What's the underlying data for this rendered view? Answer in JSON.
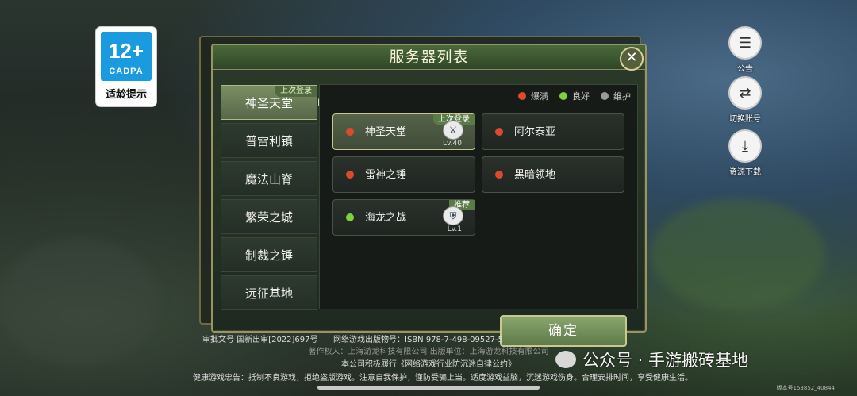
{
  "age_badge": {
    "rating": "12+",
    "org": "CADPA",
    "tip": "适龄提示"
  },
  "side_buttons": [
    {
      "icon": "notice-icon",
      "glyph": "☰",
      "label": "公告"
    },
    {
      "icon": "switch-account-icon",
      "glyph": "⇄",
      "label": "切换账号"
    },
    {
      "icon": "download-icon",
      "glyph": "⤓",
      "label": "资源下载"
    }
  ],
  "panel": {
    "title": "服务器列表",
    "close_glyph": "✕",
    "tabs": [
      {
        "label": "神圣天堂",
        "tag": "上次登录",
        "active": true
      },
      {
        "label": "普雷利镇"
      },
      {
        "label": "魔法山脊"
      },
      {
        "label": "繁荣之城"
      },
      {
        "label": "制裁之锤"
      },
      {
        "label": "远征基地"
      }
    ],
    "legend": [
      {
        "label": "爆满",
        "color": "#d94a2e"
      },
      {
        "label": "良好",
        "color": "#7ed23a"
      },
      {
        "label": "维护",
        "color": "#9a9a9a"
      }
    ],
    "servers": [
      {
        "name": "神圣天堂",
        "status_color": "#d94a2e",
        "tag": "上次登录",
        "level": "Lv.40",
        "selected": true
      },
      {
        "name": "阿尔泰亚",
        "status_color": "#d94a2e"
      },
      {
        "name": "雷神之锤",
        "status_color": "#d94a2e"
      },
      {
        "name": "黑暗领地",
        "status_color": "#d94a2e"
      },
      {
        "name": "海龙之战",
        "status_color": "#7ed23a",
        "tag": "推荐",
        "level": "Lv.1"
      }
    ],
    "confirm_label": "确定"
  },
  "footer": {
    "line1_left": "审批文号 国新出审[2022]697号",
    "line1_right": "网络游戏出版物号：ISBN 978-7-498-09527-5",
    "line2": "著作权人：上海游龙科技有限公司  出版单位：上海游龙科技有限公司",
    "line3": "本公司积极履行《网络游戏行业防沉迷自律公约》",
    "line4": "健康游戏忠告：抵制不良游戏，拒绝盗版游戏。注意自我保护，谨防受骗上当。适度游戏益脑，沉迷游戏伤身。合理安排时间，享受健康生活。",
    "watermark": "公众号 · 手游搬砖基地",
    "version": "版本号153852_40844"
  }
}
